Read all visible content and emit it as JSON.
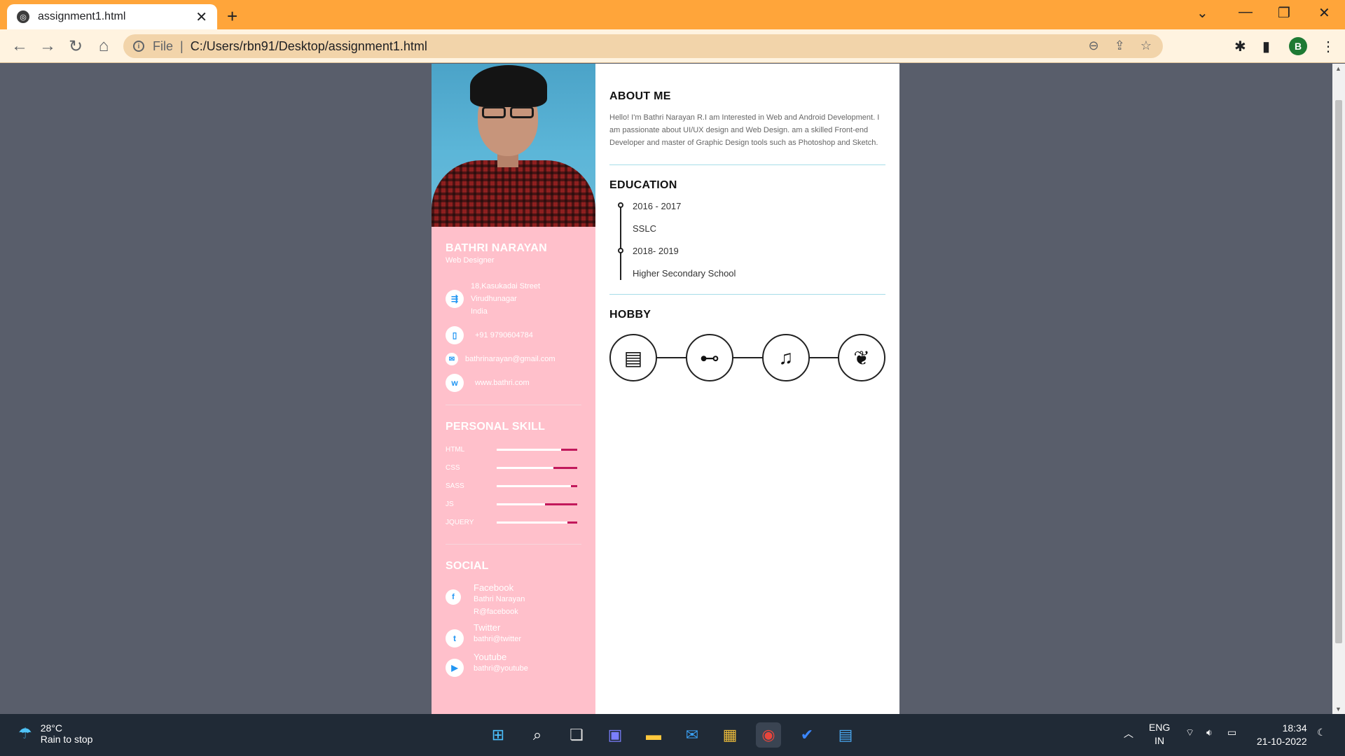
{
  "browser": {
    "tab_title": "assignment1.html",
    "tab_close": "✕",
    "new_tab": "+",
    "scheme": "File",
    "separator": "|",
    "url": "C:/Users/rbn91/Desktop/assignment1.html",
    "profile_initial": "B"
  },
  "resume": {
    "name": "BATHRI NARAYAN",
    "job": "Web Designer",
    "address": [
      "18,Kasukadai Street",
      "Virudhunagar",
      "India"
    ],
    "phone": "+91 9790604784",
    "email": "bathrinarayan@gmail.com",
    "website": "www.bathri.com",
    "skills_heading": "PERSONAL SKILL",
    "skills": [
      {
        "label": "HTML",
        "level": 0.2
      },
      {
        "label": "CSS",
        "level": 0.3
      },
      {
        "label": "SASS",
        "level": 0.08
      },
      {
        "label": "JS",
        "level": 0.4
      },
      {
        "label": "JQUERY",
        "level": 0.12
      }
    ],
    "social_heading": "SOCIAL",
    "social": [
      {
        "title": "Facebook",
        "sub": [
          "Bathri Narayan",
          "R@facebook"
        ],
        "icon": "facebook-icon"
      },
      {
        "title": "Twitter",
        "sub": [
          "bathri@twitter"
        ],
        "icon": "twitter-icon"
      },
      {
        "title": "Youtube",
        "sub": [
          "bathri@youtube"
        ],
        "icon": "youtube-icon"
      }
    ],
    "about_heading": "ABOUT ME",
    "about_text": "Hello! I'm Bathri Narayan R.I am Interested in Web and Android Development. I am passionate about UI/UX design and Web Design. am a skilled Front-end Developer and master of Graphic Design tools such as Photoshop and Sketch.",
    "education_heading": "EDUCATION",
    "education": [
      {
        "years": "2016 - 2017",
        "school": "SSLC"
      },
      {
        "years": "2018- 2019",
        "school": "Higher Secondary School"
      }
    ],
    "hobby_heading": "HOBBY",
    "hobbies": [
      "book-icon",
      "gamepad-icon",
      "music-icon",
      "plant-icon"
    ]
  },
  "taskbar": {
    "temperature": "28°C",
    "condition": "Rain to stop",
    "lang": "ENG",
    "region": "IN",
    "time": "18:34",
    "date": "21-10-2022"
  },
  "colors": {
    "tabbar": "#ffa53a",
    "sidebar_pink": "#ffc0cb",
    "skill_fill": "#c2185b",
    "page_bg": "#595e6b"
  }
}
